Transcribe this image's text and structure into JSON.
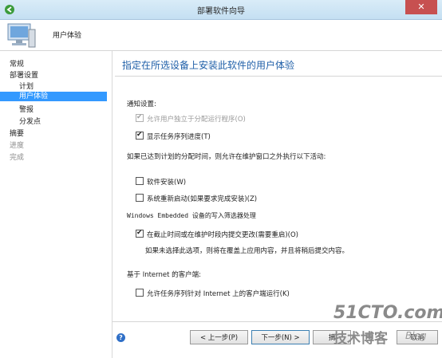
{
  "window": {
    "title": "部署软件向导",
    "close_glyph": "✕"
  },
  "header": {
    "page_name": "用户体验"
  },
  "sidebar": {
    "items": [
      {
        "label": "常规",
        "state": "normal"
      },
      {
        "label": "部署设置",
        "state": "normal"
      },
      {
        "label": "计划",
        "state": "normal"
      },
      {
        "label": "用户体验",
        "state": "active"
      },
      {
        "label": "警报",
        "state": "normal"
      },
      {
        "label": "分发点",
        "state": "normal"
      },
      {
        "label": "摘要",
        "state": "normal"
      },
      {
        "label": "进度",
        "state": "disabled"
      },
      {
        "label": "完成",
        "state": "disabled"
      }
    ]
  },
  "main": {
    "heading": "指定在所选设备上安装此软件的用户体验",
    "notification_label": "通知设置:",
    "allow_user_run": {
      "label": "允许用户独立于分配运行程序(O)",
      "checked": true,
      "enabled": false
    },
    "show_progress": {
      "label": "显示任务序列进度(T)",
      "checked": true,
      "enabled": true
    },
    "deadline_label": "如果已达到计划的分配时间，则允许在维护窗口之外执行以下活动:",
    "software_install": {
      "label": "软件安装(W)",
      "checked": false
    },
    "system_restart": {
      "label": "系统重新启动(如果要求完成安装)(Z)",
      "checked": false
    },
    "embedded_label": "Windows Embedded 设备的写入筛选器处理",
    "commit_changes": {
      "label": "在截止时间或在维护时段内提交更改(需要重启)(O)",
      "checked": true
    },
    "commit_note": "如果未选择此选项，则将在覆盖上应用内容，并且将稍后提交内容。",
    "internet_label": "基于 Internet 的客户端:",
    "allow_internet": {
      "label": "允许任务序列针对 Internet 上的客户端运行(K)",
      "checked": false
    }
  },
  "footer": {
    "help_glyph": "?",
    "back_label": "< 上一步(P)",
    "next_label": "下一步(N) >",
    "summary_label": "摘",
    "cancel_label": "取消"
  },
  "watermark": {
    "line1": "51CTO.com",
    "line2": "技术博客",
    "line3": "Blog"
  }
}
